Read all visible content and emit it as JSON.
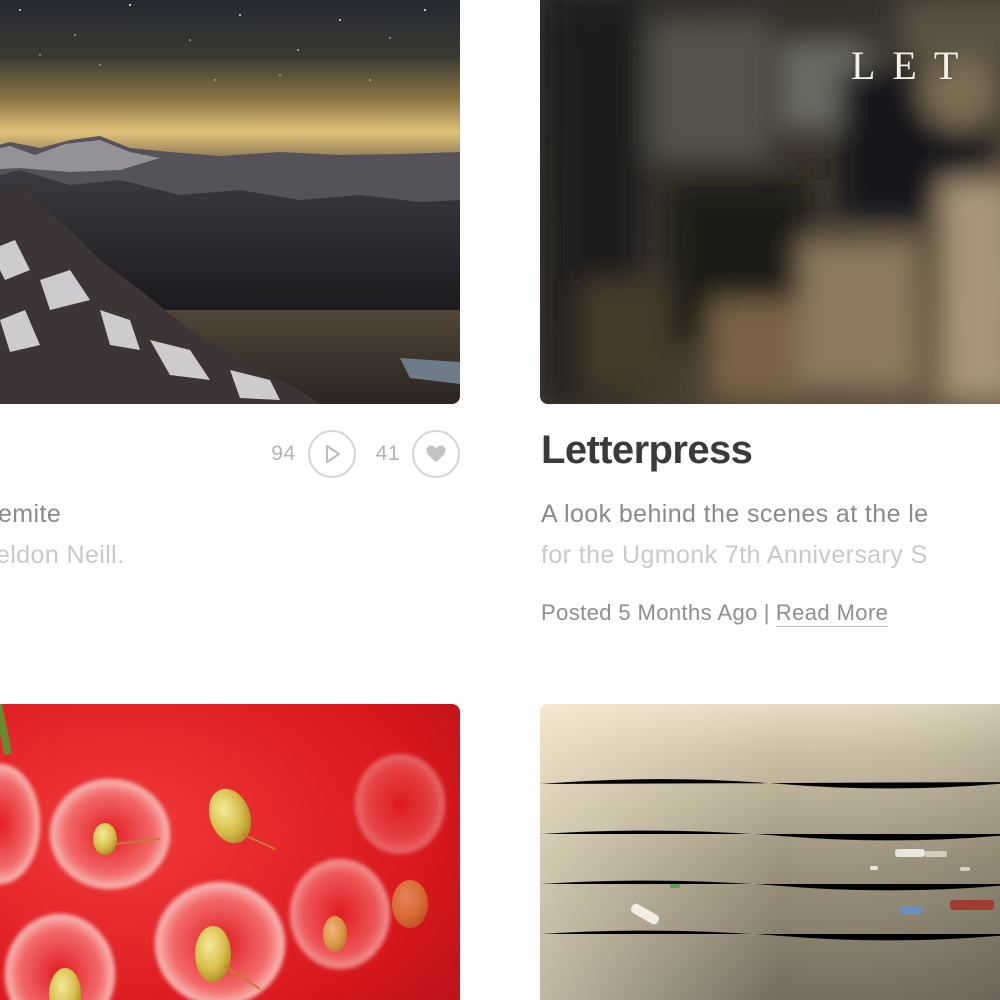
{
  "cards": {
    "yosemite": {
      "plays": "94",
      "likes": "41",
      "description_line1": "emite",
      "description_line2": "eldon Neill."
    },
    "letterpress": {
      "overlay_text": "LET",
      "title": "Letterpress",
      "description_line1": "A look behind the scenes at the le",
      "description_line2": "for the Ugmonk 7th Anniversary S",
      "posted": "Posted 5 Months Ago",
      "separator": "|",
      "read_more": "Read More"
    }
  },
  "icons": {
    "play": "play-icon",
    "like": "heart-icon"
  },
  "colors": {
    "title": "#3a3a3a",
    "body_text": "#8a8a8a",
    "muted_text": "#b3b3b3",
    "circle_border": "#d6d6d6"
  }
}
